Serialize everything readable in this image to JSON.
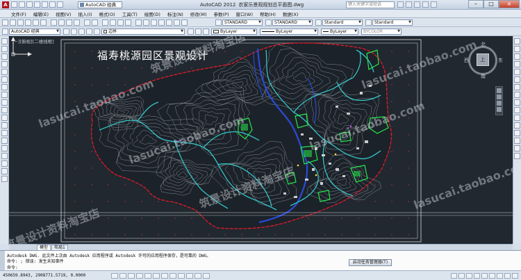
{
  "titlebar": {
    "logo": "A",
    "workspace": "AutoCAD 经典",
    "app_name": "AutoCAD 2012",
    "file_name": "农家乐景观规划总平面图.dwg",
    "search_placeholder": "键入关键字或短语"
  },
  "menu": [
    "文件(F)",
    "编辑(E)",
    "视图(V)",
    "插入(I)",
    "格式(O)",
    "工具(T)",
    "绘图(D)",
    "标注(N)",
    "修改(M)",
    "参数(P)",
    "窗口(W)",
    "帮助(H)",
    "数据(X)"
  ],
  "toolbar1": {
    "text_style": "STANDARD",
    "dim_style": "STANDARD",
    "table_style": "Standard",
    "mleader_style": "Standard"
  },
  "toolbar2": {
    "workspace": "AutoCAD 经典",
    "layer": "边界",
    "color": "ByLayer",
    "linetype": "ByLayer",
    "lineweight": "ByLayer",
    "plotstyle": "BYCOLOR"
  },
  "canvas": {
    "viewport_label": "[−][俯视][二维线框]",
    "drawing_title": "福寿桃源园区景观设计",
    "viewcube": {
      "north": "北",
      "south": "南",
      "west": "西",
      "east": "东",
      "top": "上"
    },
    "colors": {
      "background": "#212830",
      "boundary": "#e21b2a",
      "contour": "#b8bcc4",
      "water": "#2a4bd8",
      "road": "#35c4c8",
      "green": "#24e84c"
    }
  },
  "tabs": [
    "模型",
    "布局1"
  ],
  "command": {
    "line1": "Autodesk DWG.  此文件上次由 Autodesk 应用程序或 Autodesk 许可的应用程序保存，是可靠的 DWG。",
    "line2": "命令: ; 错误: 发生未知事件",
    "line3": "命令:",
    "task_manager_button": "启动任务管理器(T)"
  },
  "status": {
    "coordinates": "450659.8943, 2908771.5719, 0.0000"
  },
  "watermark": {
    "shop_url": "lasucai.taobao.com",
    "shop_name": "筑景设计资料淘宝店"
  }
}
